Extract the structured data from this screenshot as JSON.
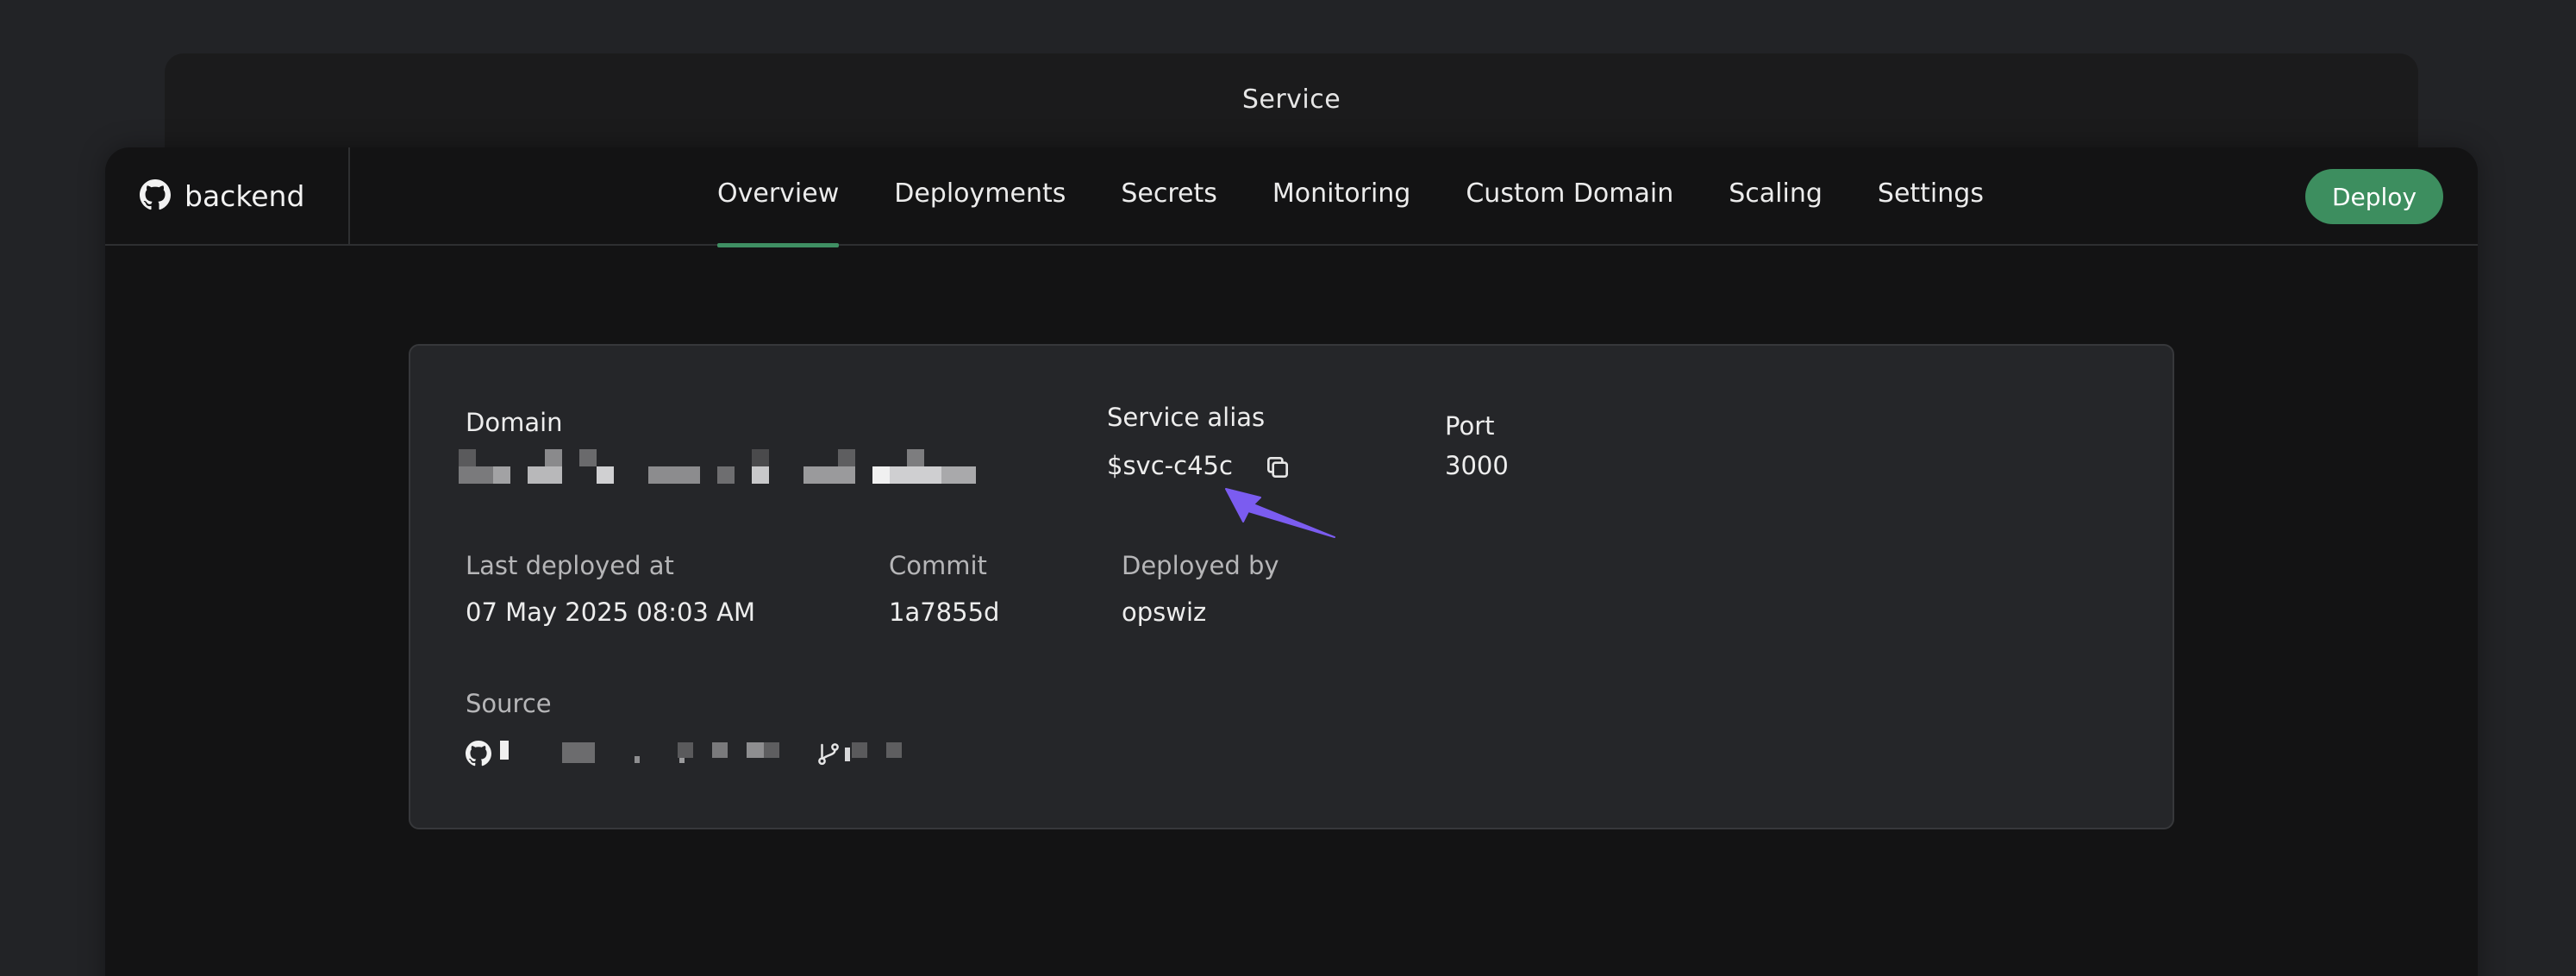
{
  "background_panel": {
    "title": "Service"
  },
  "navbar": {
    "service_name": "backend",
    "tabs": [
      {
        "label": "Overview",
        "active": true
      },
      {
        "label": "Deployments",
        "active": false
      },
      {
        "label": "Secrets",
        "active": false
      },
      {
        "label": "Monitoring",
        "active": false
      },
      {
        "label": "Custom Domain",
        "active": false
      },
      {
        "label": "Scaling",
        "active": false
      },
      {
        "label": "Settings",
        "active": false
      }
    ],
    "deploy_label": "Deploy"
  },
  "overview": {
    "domain": {
      "label": "Domain",
      "value_redacted": true
    },
    "service_alias": {
      "label": "Service alias",
      "value": "$svc-c45c"
    },
    "port": {
      "label": "Port",
      "value": "3000"
    },
    "last_deployed": {
      "label": "Last deployed at",
      "value": "07 May 2025 08:03 AM"
    },
    "commit": {
      "label": "Commit",
      "value": "1a7855d"
    },
    "deployed_by": {
      "label": "Deployed by",
      "value": "opswiz"
    },
    "source": {
      "label": "Source",
      "value_redacted": true
    }
  },
  "icons": {
    "brand": "github-icon",
    "copy": "copy-icon",
    "source_repo": "github-icon",
    "branch": "git-branch-icon"
  },
  "colors": {
    "accent_green": "#3d8e5f",
    "annotation_arrow": "#7b5cf0"
  }
}
